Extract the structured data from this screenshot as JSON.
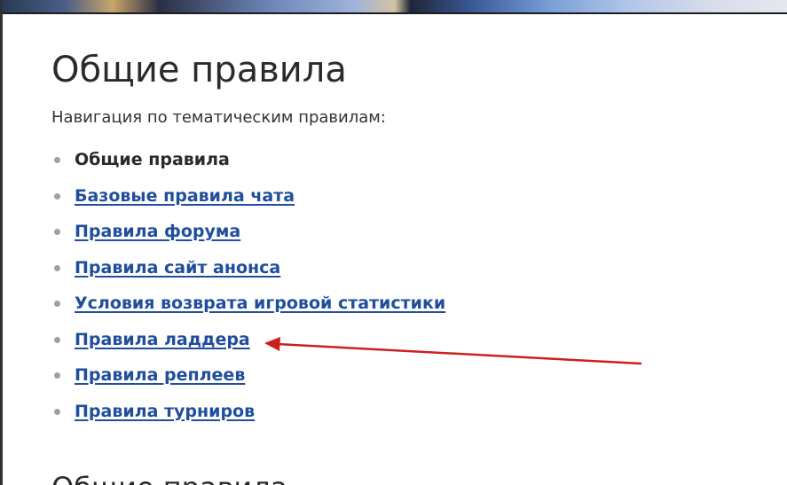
{
  "page": {
    "title": "Общие правила",
    "nav_intro": "Навигация по тематическим правилам:",
    "section_title": "Общие правила"
  },
  "nav": {
    "items": [
      {
        "label": "Общие правила",
        "current": true
      },
      {
        "label": "Базовые правила чата",
        "current": false
      },
      {
        "label": "Правила форума",
        "current": false
      },
      {
        "label": "Правила сайт анонса",
        "current": false
      },
      {
        "label": "Условия возврата игровой статистики",
        "current": false
      },
      {
        "label": "Правила ладдера",
        "current": false
      },
      {
        "label": "Правила реплеев",
        "current": false
      },
      {
        "label": "Правила турниров",
        "current": false
      }
    ]
  },
  "colors": {
    "link": "#1f4e9c",
    "text": "#2b2b2b",
    "bullet": "#9aa1a8",
    "annotation_arrow": "#cc1f1f"
  },
  "icons": {
    "annotation": "red-arrow-icon",
    "bullet": "bullet-dot-icon"
  }
}
